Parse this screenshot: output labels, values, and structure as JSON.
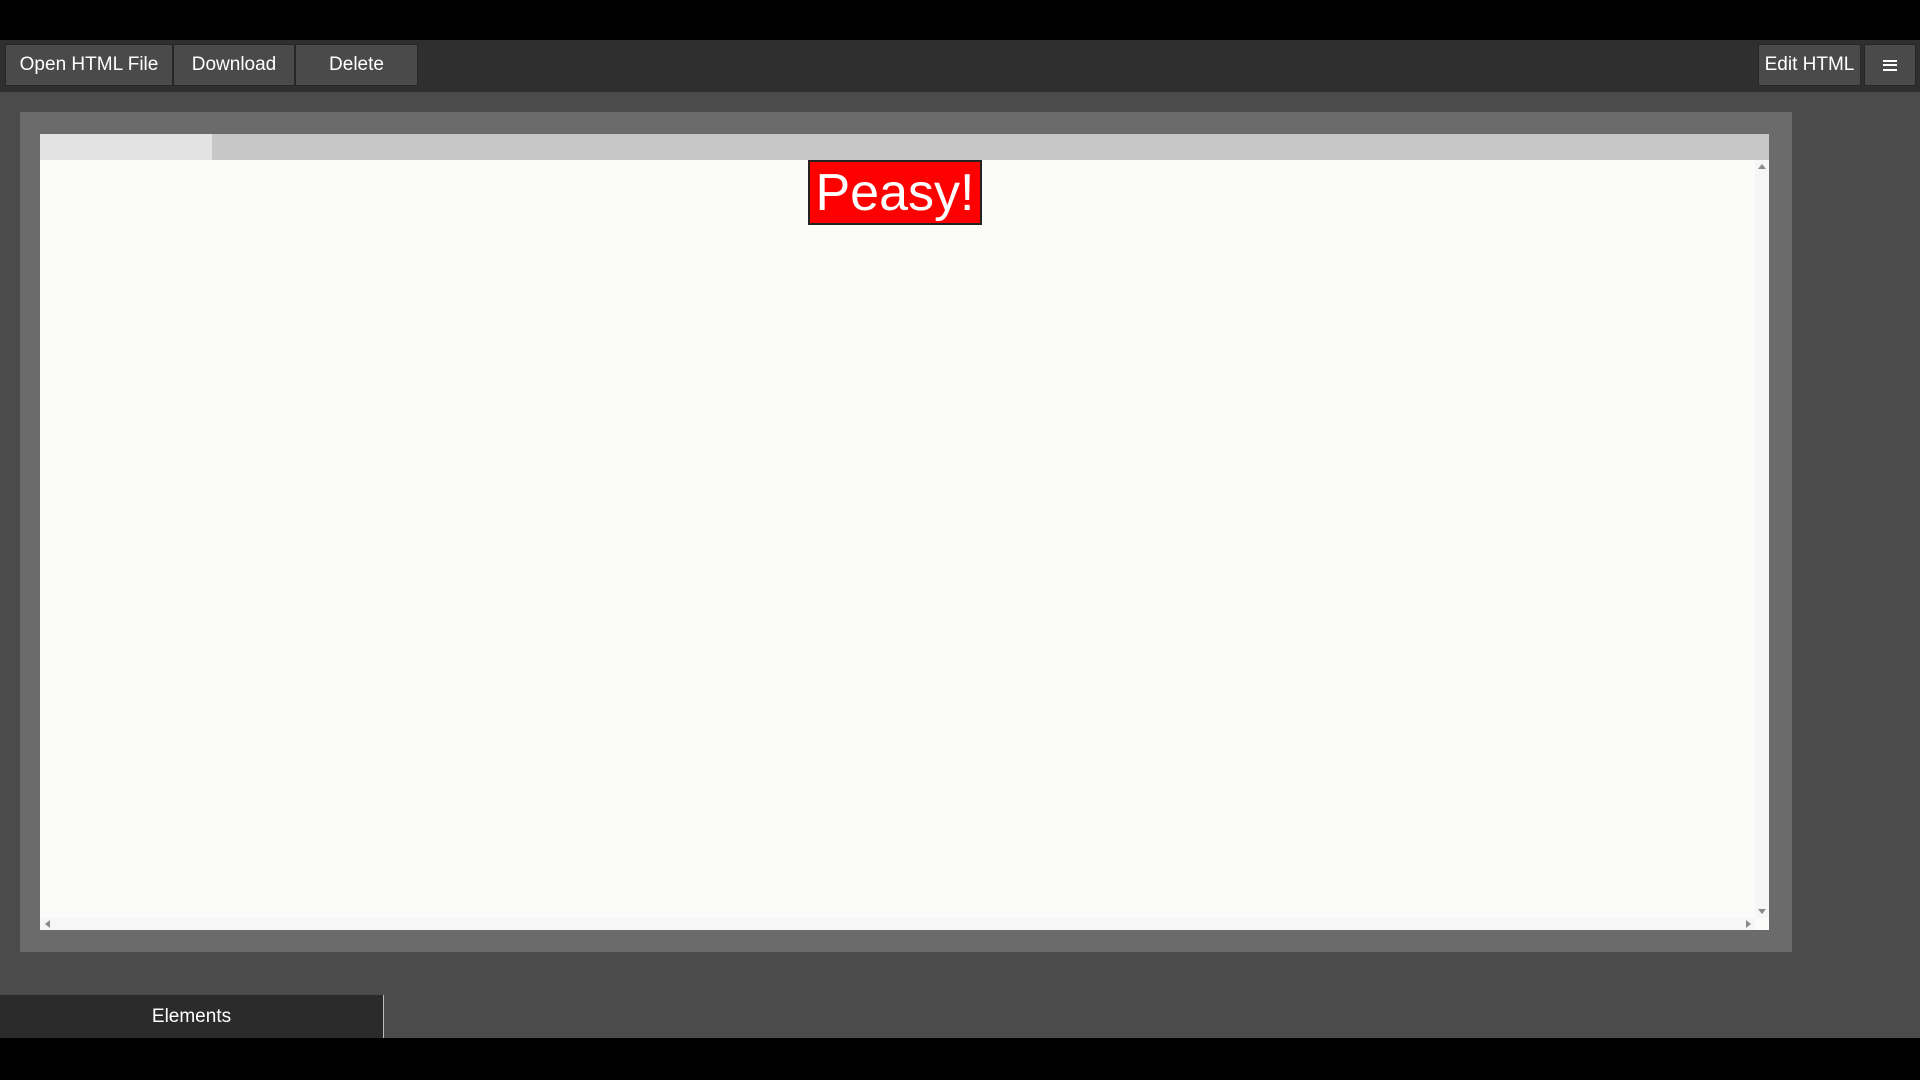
{
  "toolbar": {
    "open_label": "Open HTML File",
    "download_label": "Download",
    "delete_label": "Delete",
    "edit_label": "Edit HTML",
    "menu_icon": "hamburger-menu-icon"
  },
  "canvas": {
    "element_text": "Peasy!",
    "element_color": "#ff0000"
  },
  "bottom_panel": {
    "tab_label": "Elements"
  }
}
